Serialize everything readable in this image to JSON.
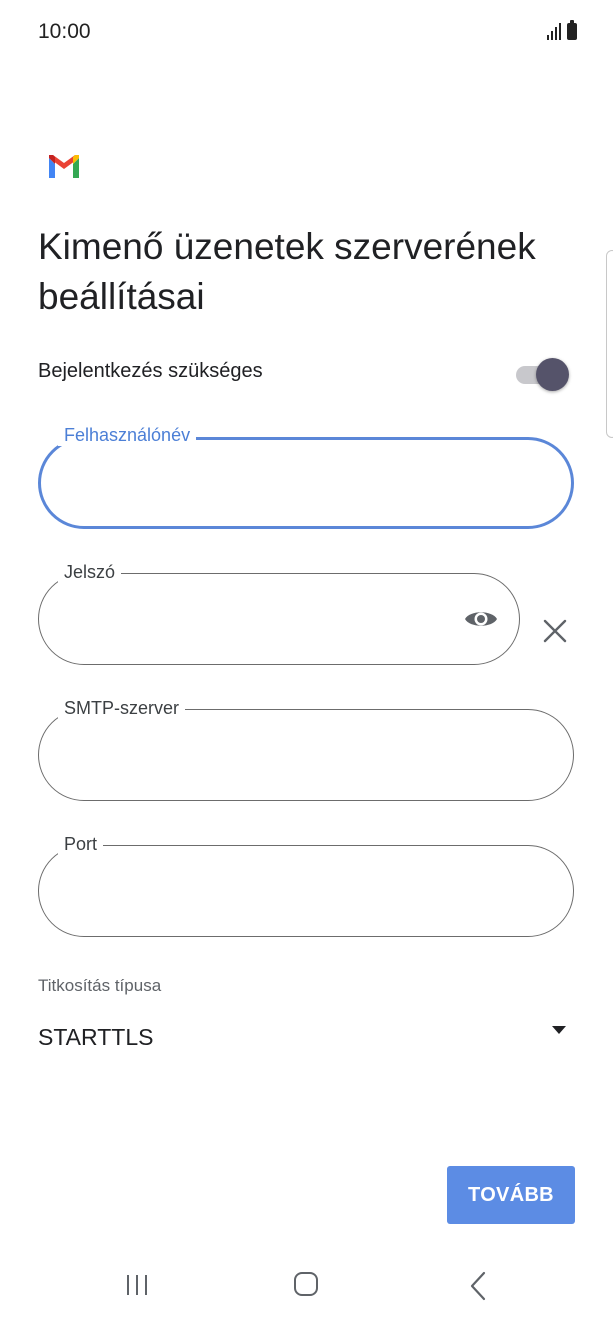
{
  "status_bar": {
    "time": "10:00",
    "icons": [
      "signal-icon",
      "battery-icon"
    ]
  },
  "app": {
    "logo": "gmail-logo",
    "title": "Kimenő üzenetek szerverének beállításai"
  },
  "login_required": {
    "label": "Bejelentkezés szükséges",
    "enabled": true
  },
  "fields": {
    "username": {
      "label": "Felhasználónév",
      "value": "",
      "focused": true
    },
    "password": {
      "label": "Jelszó",
      "value": "",
      "icons": [
        "eye-icon",
        "close-icon"
      ]
    },
    "smtp_server": {
      "label": "SMTP-szerver",
      "value": ""
    },
    "port": {
      "label": "Port",
      "value": ""
    }
  },
  "encryption": {
    "label": "Titkosítás típusa",
    "selected": "STARTTLS"
  },
  "actions": {
    "next_label": "TOVÁBB"
  },
  "navigation": {
    "icons": [
      "recent-apps-icon",
      "home-icon",
      "back-icon"
    ]
  },
  "colors": {
    "accent": "#5c8ce4",
    "focus": "#4c7fd6",
    "toggle_thumb": "#55536a"
  }
}
